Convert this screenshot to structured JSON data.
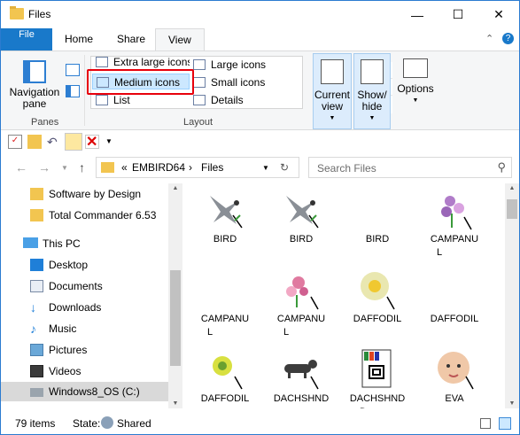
{
  "window": {
    "title": "Files",
    "minimize": "—",
    "maximize": "☐",
    "close": "✕"
  },
  "tabs": [
    "File",
    "Home",
    "Share",
    "View"
  ],
  "ribbon": {
    "navigation_pane": "Navigation pane",
    "panes_label": "Panes",
    "layout_items": [
      "Extra large icons",
      "Large icons",
      "Medium icons",
      "Small icons",
      "List",
      "Details"
    ],
    "layout_selected": "Medium icons",
    "layout_label": "Layout",
    "current_view": "Current view",
    "show_hide": "Show/ hide",
    "options": "Options"
  },
  "address": {
    "crumbs": [
      "«",
      "EMBIRD64",
      "›",
      "Files"
    ],
    "search_placeholder": "Search Files"
  },
  "nav_tree": [
    {
      "label": "Software by Design",
      "icon": "folder-sync-icon"
    },
    {
      "label": "Total Commander 6.53",
      "icon": "folder-sync-icon"
    },
    {
      "label": "This PC",
      "icon": "pc-icon"
    },
    {
      "label": "Desktop",
      "icon": "desktop-icon"
    },
    {
      "label": "Documents",
      "icon": "documents-icon"
    },
    {
      "label": "Downloads",
      "icon": "downloads-icon"
    },
    {
      "label": "Music",
      "icon": "music-icon"
    },
    {
      "label": "Pictures",
      "icon": "pictures-icon"
    },
    {
      "label": "Videos",
      "icon": "videos-icon"
    },
    {
      "label": "Windows8_OS (C:)",
      "icon": "drive-icon"
    }
  ],
  "files": [
    {
      "line1": "BIRD",
      "line2": "",
      "icon": "bird"
    },
    {
      "line1": "BIRD",
      "line2": "",
      "icon": "bird"
    },
    {
      "line1": "BIRD",
      "line2": "",
      "icon": "none"
    },
    {
      "line1": "CAMPANU",
      "line2": "L",
      "icon": "flower-purple"
    },
    {
      "line1": "CAMPANU",
      "line2": "L",
      "icon": "none"
    },
    {
      "line1": "CAMPANU",
      "line2": "L",
      "icon": "flower-pink"
    },
    {
      "line1": "DAFFODIL",
      "line2": "",
      "icon": "daffodil"
    },
    {
      "line1": "DAFFODIL",
      "line2": "",
      "icon": "none"
    },
    {
      "line1": "DAFFODIL",
      "line2": "",
      "icon": "daffodil-small"
    },
    {
      "line1": "DACHSHND",
      "line2": "",
      "icon": "dog"
    },
    {
      "line1": "DACHSHND",
      "line2": "D",
      "icon": "doc"
    },
    {
      "line1": "EVA",
      "line2": "",
      "icon": "baby"
    }
  ],
  "status": {
    "count": "79 items",
    "state_label": "State:",
    "state_value": "Shared"
  }
}
